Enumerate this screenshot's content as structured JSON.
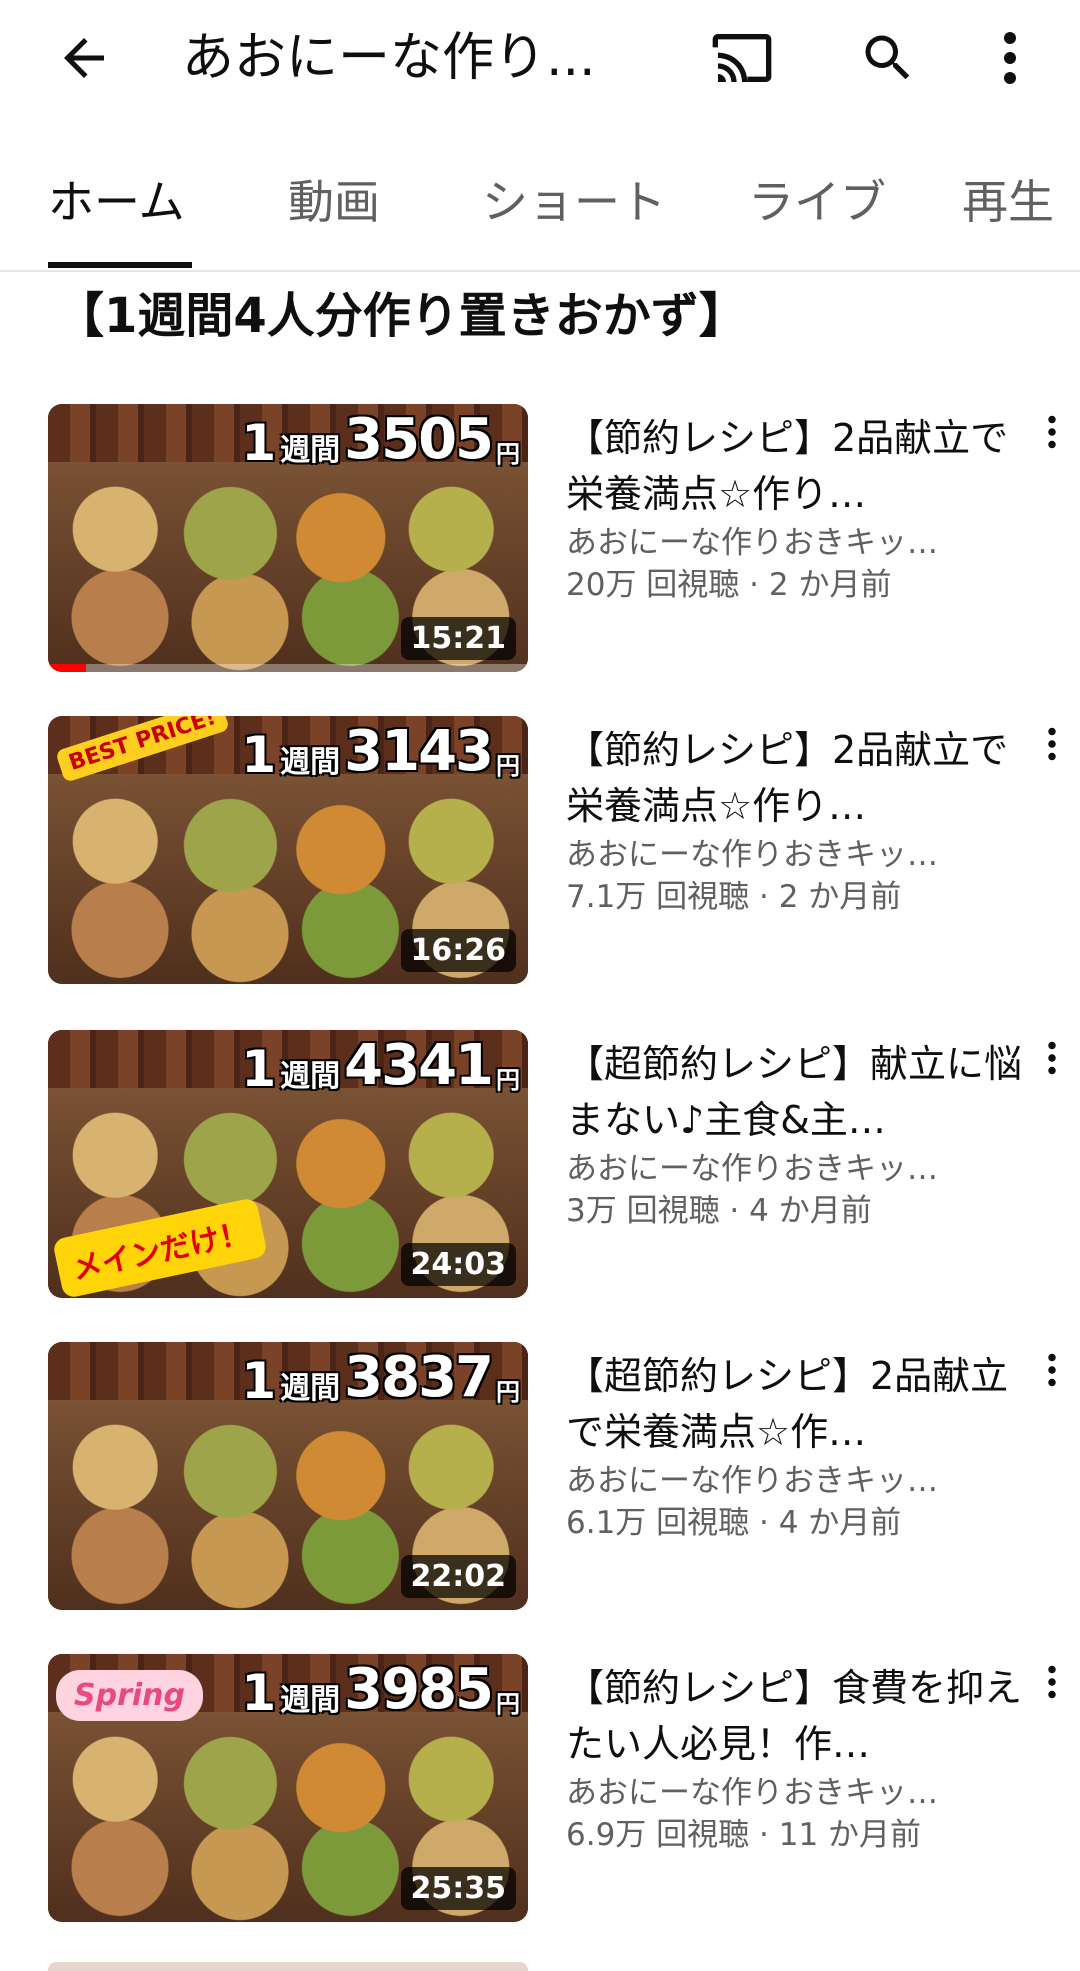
{
  "header": {
    "title": "あおにーな作り..."
  },
  "tabs": [
    {
      "label": "ホーム"
    },
    {
      "label": "動画"
    },
    {
      "label": "ショート"
    },
    {
      "label": "ライブ"
    },
    {
      "label": "再生"
    }
  ],
  "section": {
    "title": "【1週間4人分作り置きおかず】"
  },
  "videos": [
    {
      "title": "【節約レシピ】2品献立で栄養満点☆作り…",
      "channel": "あおにーな作りおきキッ…",
      "stats": "20万 回視聴 · 2 か月前",
      "duration": "15:21",
      "price": "3505",
      "price_prefix": "1",
      "price_unit": "週間",
      "price_suffix": "円",
      "progress_percent": 8
    },
    {
      "title": "【節約レシピ】2品献立で栄養満点☆作り…",
      "channel": "あおにーな作りおきキッ…",
      "stats": "7.1万 回視聴 · 2 か月前",
      "duration": "16:26",
      "price": "3143",
      "price_prefix": "1",
      "price_unit": "週間",
      "price_suffix": "円",
      "badge": "BEST PRICE!"
    },
    {
      "title": "【超節約レシピ】献立に悩まない♪主食&主…",
      "channel": "あおにーな作りおきキッ…",
      "stats": "3万 回視聴 · 4 か月前",
      "duration": "24:03",
      "price": "4341",
      "price_prefix": "1",
      "price_unit": "週間",
      "price_suffix": "円",
      "badge": "メインだけ！"
    },
    {
      "title": "【超節約レシピ】2品献立で栄養満点☆作…",
      "channel": "あおにーな作りおきキッ…",
      "stats": "6.1万 回視聴 · 4 か月前",
      "duration": "22:02",
      "price": "3837",
      "price_prefix": "1",
      "price_unit": "週間",
      "price_suffix": "円"
    },
    {
      "title": "【節約レシピ】食費を抑えたい人必見！作…",
      "channel": "あおにーな作りおきキッ…",
      "stats": "6.9万 回視聴 · 11 か月前",
      "duration": "25:35",
      "price": "3985",
      "price_prefix": "1",
      "price_unit": "週間",
      "price_suffix": "円",
      "badge": "Spring"
    }
  ],
  "icons": {
    "back": "back-arrow-icon",
    "cast": "cast-icon",
    "search": "search-icon",
    "more": "more-vertical-icon"
  },
  "colors": {
    "text": "#0f0f0f",
    "secondary_text": "#606060",
    "progress": "#ff0000"
  }
}
